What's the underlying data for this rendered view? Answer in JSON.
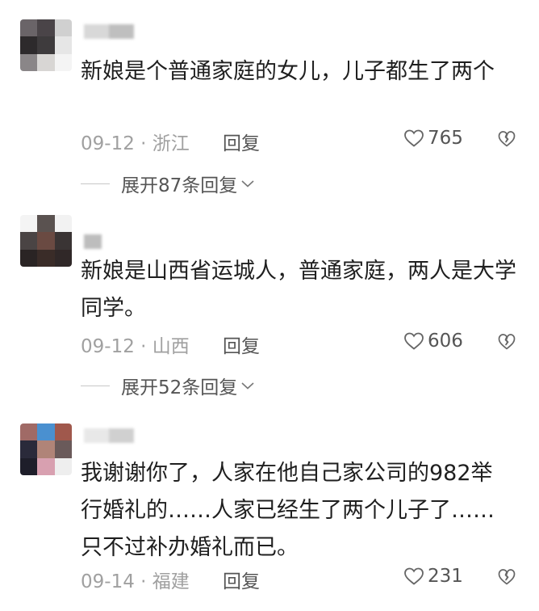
{
  "comments": [
    {
      "content": "新娘是个普通家庭的女儿，儿子都生了两个",
      "date_location": "09-12 · 浙江",
      "reply_label": "回复",
      "likes": "765",
      "expand_label": "展开87条回复",
      "avatar_colors": [
        "#6a6468",
        "#4a4448",
        "#d0d0d0",
        "#2d2a2c",
        "#3e3b3d",
        "#e6e6e6",
        "#8a8688",
        "#d8d6d4",
        "#f4f4f4"
      ],
      "name_colors": [
        "#d8d8d8",
        "#bfbfbf"
      ]
    },
    {
      "content": "新娘是山西省运城人，普通家庭，两人是大学同学。",
      "date_location": "09-12 · 山西",
      "reply_label": "回复",
      "likes": "606",
      "expand_label": "展开52条回复",
      "avatar_colors": [
        "#f4f4f4",
        "#5a5250",
        "#f2f2f2",
        "#4a4444",
        "#6a4a42",
        "#3a3434",
        "#2a2424",
        "#3a2c28",
        "#302828"
      ],
      "name_colors": [
        "#bdbdbd",
        "#bdbdbd"
      ]
    },
    {
      "content": "我谢谢你了，人家在他自己家公司的982举行婚礼的……人家已经生了两个儿子了……只不过补办婚礼而已。",
      "date_location": "09-14 · 福建",
      "reply_label": "回复",
      "likes": "231",
      "expand_label": "",
      "avatar_colors": [
        "#a06a66",
        "#4a90d0",
        "#a0584c",
        "#2a2a3a",
        "#b08478",
        "#6a5a5a",
        "#1e1e2a",
        "#d8a0b0",
        "#eeeeee"
      ],
      "name_colors": [
        "#e8e8e8",
        "#d0d0d0"
      ]
    }
  ]
}
